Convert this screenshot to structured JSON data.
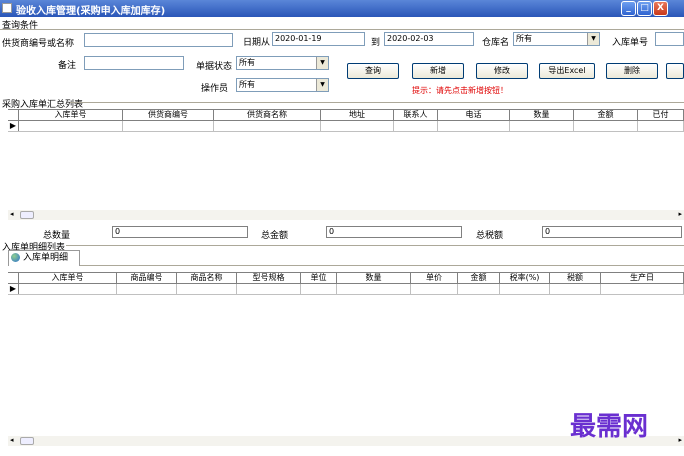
{
  "window": {
    "title": "验收入库管理(采购申入库加库存)",
    "minimize": "_",
    "maximize": "□",
    "close": "X"
  },
  "query": {
    "section_title": "查询条件",
    "supplier_label": "供货商编号或名称",
    "supplier_value": "",
    "date_from_label": "日期从",
    "date_from": "2020-01-19",
    "date_to_label": "到",
    "date_to": "2020-02-03",
    "warehouse_label": "仓库名",
    "warehouse_value": "所有",
    "order_no_label": "入库单号",
    "order_no_value": "",
    "remark_label": "备注",
    "remark_value": "",
    "status_label": "单据状态",
    "status_value": "所有",
    "operator_label": "操作员",
    "operator_value": "所有"
  },
  "buttons": {
    "query": "查询",
    "add": "新增",
    "edit": "修改",
    "export": "导出Excel",
    "delete": "删除"
  },
  "hint": "提示：请先点击新增按钮！",
  "summary_list": {
    "title": "采购入库单汇总列表",
    "columns": [
      "入库单号",
      "供货商编号",
      "供货商名称",
      "地址",
      "联系人",
      "电话",
      "数量",
      "金额",
      "已付"
    ],
    "row_indicator": "▶"
  },
  "totals": {
    "qty_label": "总数量",
    "qty_value": "0",
    "amount_label": "总金额",
    "amount_value": "0",
    "tax_label": "总税额",
    "tax_value": "0"
  },
  "detail_list": {
    "title": "入库单明细列表",
    "tab_label": "入库单明细",
    "columns": [
      "入库单号",
      "商品编号",
      "商品名称",
      "型号规格",
      "单位",
      "数量",
      "单价",
      "金额",
      "税率(%)",
      "税额",
      "生产日"
    ],
    "row_indicator": "▶"
  },
  "scroll": {
    "left_arrow": "◂",
    "right_arrow": "▸"
  },
  "watermark": "最需网",
  "colors": {
    "titlebar": "#2a56b8",
    "hint": "#e00000",
    "watermark": "#6a2fd0"
  }
}
